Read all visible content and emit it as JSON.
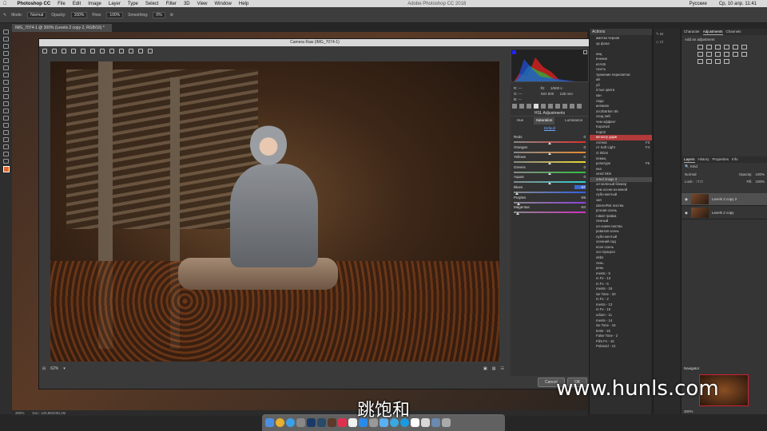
{
  "menubar": {
    "app": "Photoshop CC",
    "items": [
      "File",
      "Edit",
      "Image",
      "Layer",
      "Type",
      "Select",
      "Filter",
      "3D",
      "View",
      "Window",
      "Help"
    ],
    "title": "Adobe Photoshop CC 2018",
    "lang": "Русские",
    "clock": "Ср, 10 апр. 11:41"
  },
  "options": {
    "mode_label": "Mode:",
    "mode_value": "Normal",
    "opacity_label": "Opacity:",
    "opacity_value": "100%",
    "flow_label": "Flow:",
    "flow_value": "100%",
    "smoothing_label": "Smoothing:",
    "smoothing_value": "0%"
  },
  "doc_tab": "IMG_7074-1 @ 300% (Levels 2 copy 2, RGB/16) *",
  "camera_raw": {
    "title": "Camera Raw (IMG_7074-1)",
    "zoom": "62%",
    "cancel_label": "Cancel",
    "ok_label": "OK",
    "cam_values": {
      "r_label": "R:",
      "r": "---",
      "g_label": "G:",
      "g": "---",
      "b_label": "B:",
      "b": "---",
      "aperture": "f/2",
      "shutter": "1/500 s",
      "iso": "ISO 500",
      "focal": "135 mm"
    },
    "hsl": {
      "title": "HSL Adjustments",
      "tabs": [
        "Hue",
        "Saturation",
        "Luminance"
      ],
      "active_tab": 1,
      "default_label": "Default",
      "sliders": [
        {
          "label": "Reds",
          "value": "0",
          "pos": 0.5,
          "grad": "linear-gradient(90deg,#888,#e03030)",
          "selected": false
        },
        {
          "label": "Oranges",
          "value": "0",
          "pos": 0.5,
          "grad": "linear-gradient(90deg,#888,#e88a30)",
          "selected": false
        },
        {
          "label": "Yellows",
          "value": "0",
          "pos": 0.5,
          "grad": "linear-gradient(90deg,#888,#e8d830)",
          "selected": false
        },
        {
          "label": "Greens",
          "value": "0",
          "pos": 0.5,
          "grad": "linear-gradient(90deg,#888,#30c040)",
          "selected": false
        },
        {
          "label": "Aquas",
          "value": "0",
          "pos": 0.5,
          "grad": "linear-gradient(90deg,#888,#30d0d0)",
          "selected": false
        },
        {
          "label": "Blues",
          "value": "-97",
          "pos": 0.04,
          "grad": "linear-gradient(90deg,#888,#3060e8)",
          "selected": true
        },
        {
          "label": "Purples",
          "value": "-89",
          "pos": 0.07,
          "grad": "linear-gradient(90deg,#888,#9040e0)",
          "selected": false
        },
        {
          "label": "Magentas",
          "value": "-94",
          "pos": 0.05,
          "grad": "linear-gradient(90deg,#888,#d030c0)",
          "selected": false
        }
      ]
    }
  },
  "actions": {
    "title": "Actions",
    "items": [
      {
        "t": "иметка черная",
        "k": "",
        "s": ""
      },
      {
        "t": "ор фона",
        "k": "",
        "s": ""
      },
      {
        "t": "",
        "k": "",
        "s": ""
      },
      {
        "t": "ниц",
        "k": "",
        "s": ""
      },
      {
        "t": "ичение",
        "k": "",
        "s": ""
      },
      {
        "t": "итАсБ",
        "k": "",
        "s": ""
      },
      {
        "t": "гкость",
        "k": "",
        "s": ""
      },
      {
        "t": "транение пересветов",
        "k": "",
        "s": ""
      },
      {
        "t": "ай",
        "k": "",
        "s": ""
      },
      {
        "t": "уб",
        "k": "",
        "s": ""
      },
      {
        "t": "істые цвета",
        "k": "",
        "s": ""
      },
      {
        "t": "кан",
        "k": "",
        "s": ""
      },
      {
        "t": "ляде",
        "k": "",
        "s": ""
      },
      {
        "t": "ингмилк",
        "k": "",
        "s": ""
      },
      {
        "t": "ато/Darken 55",
        "k": "",
        "s": ""
      },
      {
        "t": "сенд пиб",
        "k": "",
        "s": ""
      },
      {
        "t": "чем-эффект",
        "k": "",
        "s": ""
      },
      {
        "t": "Koporw2",
        "k": "",
        "s": ""
      },
      {
        "t": "Корп2",
        "k": "",
        "s": ""
      },
      {
        "t": "ив-копу дорж",
        "k": "",
        "s": "hl"
      },
      {
        "t": "лотека",
        "k": "F3",
        "s": ""
      },
      {
        "t": "лт Soft Light",
        "k": "F4",
        "s": ""
      },
      {
        "t": "ct Skins",
        "k": "",
        "s": ""
      },
      {
        "t": "пемец",
        "k": "",
        "s": ""
      },
      {
        "t": "ропатуре",
        "k": "F6",
        "s": ""
      },
      {
        "t": "ека",
        "k": "",
        "s": ""
      },
      {
        "t": "iored Skin",
        "k": "",
        "s": ""
      },
      {
        "t": "orted image 2",
        "k": "",
        "s": "gray"
      },
      {
        "t": "ол-зеленый бликер",
        "k": "",
        "s": ""
      },
      {
        "t": "чем осени из виной",
        "k": "",
        "s": ""
      },
      {
        "t": "лубо-желтый",
        "k": "",
        "s": ""
      },
      {
        "t": "зая",
        "k": "",
        "s": ""
      },
      {
        "t": "кЗеле/Rot листва",
        "k": "",
        "s": ""
      },
      {
        "t": "ргоная осень",
        "k": "",
        "s": ""
      },
      {
        "t": "говая травка",
        "k": "",
        "s": ""
      },
      {
        "t": "ленный",
        "k": "",
        "s": ""
      },
      {
        "t": "ол-синяя листва",
        "k": "",
        "s": ""
      },
      {
        "t": "роватая осень",
        "k": "",
        "s": ""
      },
      {
        "t": "лубо-желтый",
        "k": "",
        "s": ""
      },
      {
        "t": "осенний сад",
        "k": "",
        "s": ""
      },
      {
        "t": "ясен осень",
        "k": "",
        "s": ""
      },
      {
        "t": "осс-процесс",
        "k": "",
        "s": ""
      },
      {
        "t": "ebbs",
        "k": "",
        "s": ""
      },
      {
        "t": "лень",
        "k": "",
        "s": ""
      },
      {
        "t": "рень",
        "k": "",
        "s": ""
      },
      {
        "t": "ments - 5",
        "k": "",
        "s": ""
      },
      {
        "t": "m Fx - 13",
        "k": "",
        "s": ""
      },
      {
        "t": "m Fx - 6",
        "k": "",
        "s": ""
      },
      {
        "t": "ments - 19",
        "k": "",
        "s": ""
      },
      {
        "t": "ise Tone - 20",
        "k": "",
        "s": ""
      },
      {
        "t": "m Fx - 2",
        "k": "",
        "s": ""
      },
      {
        "t": "ments - 13",
        "k": "",
        "s": ""
      },
      {
        "t": "m Fx - 15",
        "k": "",
        "s": ""
      },
      {
        "t": "edium - 11",
        "k": "",
        "s": ""
      },
      {
        "t": "ments - 14",
        "k": "",
        "s": ""
      },
      {
        "t": "ise Tone - 16",
        "k": "",
        "s": ""
      },
      {
        "t": "tents - 15",
        "k": "",
        "s": ""
      },
      {
        "t": "False Tone - 2",
        "k": "",
        "s": ""
      },
      {
        "t": "Film Fx - 15",
        "k": "",
        "s": ""
      },
      {
        "t": "Polaroid - 12",
        "k": "",
        "s": ""
      }
    ]
  },
  "right": {
    "top_tabs": [
      "Character",
      "Adjustments",
      "Channels"
    ],
    "adj_title": "Add an adjustment",
    "layers_tabs": [
      "Layers",
      "History",
      "Properties",
      "Info"
    ],
    "kind_label": "Kind",
    "blend_value": "Normal",
    "opacity_label": "Opacity:",
    "opacity_value": "100%",
    "lock_label": "Lock:",
    "fill_label": "Fill:",
    "fill_value": "100%",
    "layers": [
      {
        "name": "Levels 2 copy 2",
        "selected": true
      },
      {
        "name": "Levels 2 copy",
        "selected": false
      }
    ],
    "navigator_title": "Navigator",
    "nav_zoom": "300%"
  },
  "status": {
    "zoom": "300%",
    "doc": "Doc: 120,8M/208,1M"
  },
  "subtitle": "跳饱和",
  "watermark": "www.hunls.com"
}
